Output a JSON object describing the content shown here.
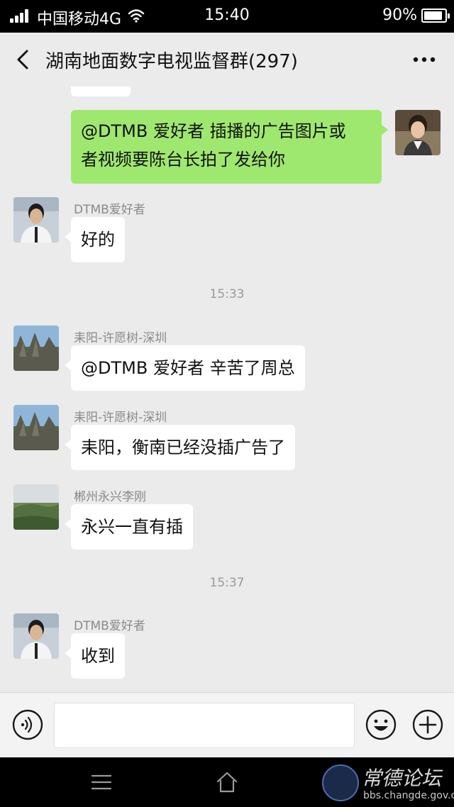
{
  "status_bar": {
    "carrier": "中国移动4G",
    "time": "15:40",
    "battery": "90%",
    "battery_level": 0.9
  },
  "header": {
    "title": "湖南地面数字电视监督群(297)"
  },
  "messages": [
    {
      "side": "right",
      "text_lines": [
        "@DTMB 爱好者  插播的广告图片或",
        "者视频要陈台长拍了发给你"
      ]
    },
    {
      "side": "left",
      "sender": "DTMB爱好者",
      "text": "好的"
    },
    {
      "type": "timestamp",
      "text": "15:33"
    },
    {
      "side": "left",
      "sender": "耒阳-许愿树-深圳",
      "text": "@DTMB 爱好者  辛苦了周总"
    },
    {
      "side": "left",
      "sender": "耒阳-许愿树-深圳",
      "text": "耒阳，衡南已经没插广告了"
    },
    {
      "side": "left",
      "sender": "郴州永兴李刚",
      "text": "永兴一直有插"
    },
    {
      "type": "timestamp",
      "text": "15:37"
    },
    {
      "side": "left",
      "sender": "DTMB爱好者",
      "text": "收到"
    }
  ],
  "watermark": {
    "title": "常德论坛",
    "url": "bbs.changde.gov.cn"
  },
  "icons": [
    "signal-icon",
    "wifi-icon",
    "battery-icon",
    "back-icon",
    "more-icon",
    "voice-icon",
    "emoji-icon",
    "plus-icon",
    "menu-icon",
    "home-icon"
  ]
}
